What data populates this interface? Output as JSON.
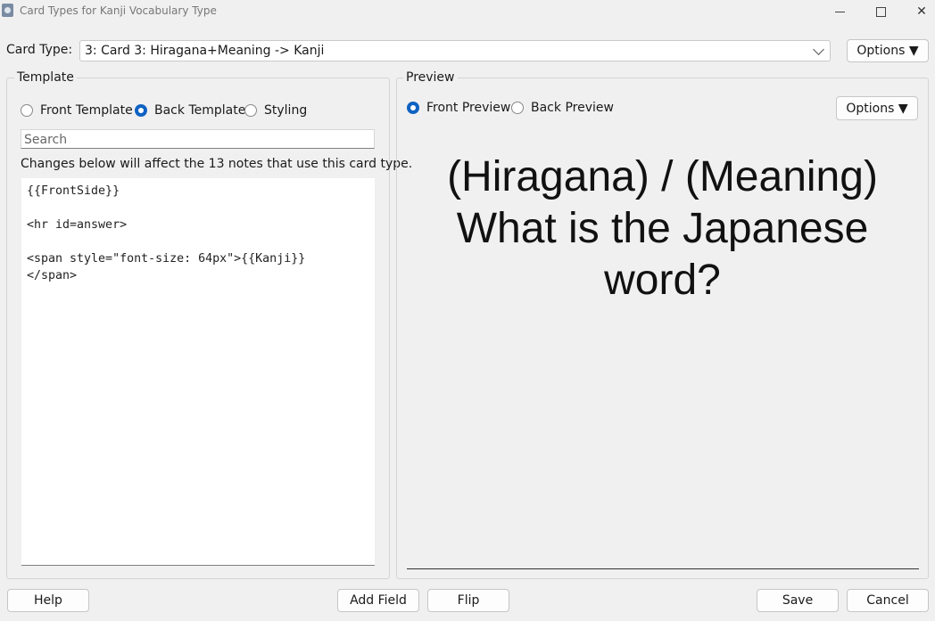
{
  "window": {
    "title": "Card Types for Kanji Vocabulary Type",
    "min_glyph": "–",
    "max_glyph": "☐",
    "close_glyph": "✕"
  },
  "cardtype": {
    "label": "Card Type:",
    "selected": "3: Card 3: Hiragana+Meaning -> Kanji",
    "options_button": "Options ▼"
  },
  "template": {
    "group_title": "Template",
    "tabs": [
      {
        "label": "Front Template",
        "checked": false
      },
      {
        "label": "Back Template",
        "checked": true
      },
      {
        "label": "Styling",
        "checked": false
      }
    ],
    "search_placeholder": "Search",
    "notice": "Changes below will affect the 13 notes that use this card type.",
    "editor_lines": [
      "{{FrontSide}}",
      "",
      "<hr id=answer>",
      "",
      "<span style=\"font-size: 64px\">{{Kanji}}",
      "</span>"
    ]
  },
  "preview": {
    "group_title": "Preview",
    "tabs": [
      {
        "label": "Front Preview",
        "checked": true
      },
      {
        "label": "Back Preview",
        "checked": false
      }
    ],
    "options_button": "Options ▼",
    "lines": [
      "(Hiragana) / (Meaning)",
      "What is the Japanese",
      "word?"
    ]
  },
  "footer": {
    "help": "Help",
    "add_field": "Add Field",
    "flip": "Flip",
    "save": "Save",
    "cancel": "Cancel"
  },
  "colors": {
    "accent": "#0f62c2",
    "background": "#f0f0f0"
  }
}
